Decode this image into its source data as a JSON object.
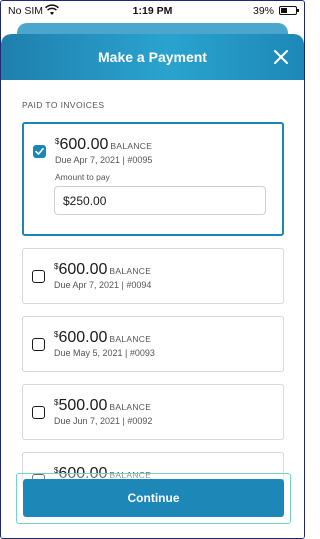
{
  "status_bar": {
    "carrier": "No SIM",
    "time": "1:19 PM",
    "battery_percent": "39%",
    "icons": [
      "wifi-icon",
      "battery-icon"
    ]
  },
  "modal": {
    "title": "Make a Payment",
    "close_icon": "close-icon",
    "section_label": "PAID TO INVOICES",
    "balance_label": "BALANCE",
    "currency_symbol": "$",
    "amount_to_pay_label": "Amount to pay",
    "amount_to_pay_value": "$250.00",
    "invoices": [
      {
        "amount": "600.00",
        "due": "Due Apr 7, 2021 | #0095",
        "checked": true
      },
      {
        "amount": "600.00",
        "due": "Due Apr 7, 2021 | #0094",
        "checked": false
      },
      {
        "amount": "600.00",
        "due": "Due May 5, 2021 | #0093",
        "checked": false
      },
      {
        "amount": "500.00",
        "due": "Due Jun 7, 2021 | #0092",
        "checked": false
      },
      {
        "amount": "600.00",
        "due": "",
        "checked": false
      }
    ],
    "continue_label": "Continue"
  },
  "colors": {
    "accent": "#1d88b8",
    "header_gradient_start": "#1f7fad",
    "header_gradient_end": "#2aa3cf",
    "focus_ring": "#72d5c2"
  }
}
